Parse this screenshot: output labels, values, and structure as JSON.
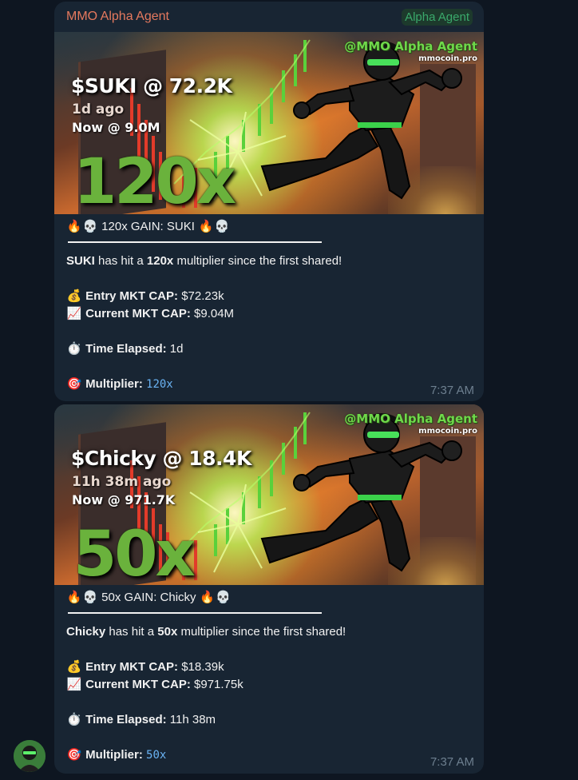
{
  "chat": {
    "sender_name": "MMO Alpha Agent",
    "admin_badge": "Alpha Agent",
    "avatar_icon": "agent-avatar"
  },
  "messages": [
    {
      "banner": {
        "watermark": "@MMO Alpha Agent",
        "site": "mmocoin.pro",
        "title": "$SUKI @ 72.2K",
        "ago": "1d ago",
        "now": "Now @ 9.0M",
        "multiplier": "120x"
      },
      "headline": "120x GAIN: SUKI",
      "token": "SUKI",
      "has_hit_a": "has hit a",
      "mult": "120x",
      "since": "multiplier since the first shared!",
      "entry_label": "Entry MKT CAP:",
      "entry_value": "$72.23k",
      "current_label": "Current MKT CAP:",
      "current_value": "$9.04M",
      "elapsed_label": "Time Elapsed:",
      "elapsed_value": "1d",
      "multiplier_label": "Multiplier:",
      "multiplier_value": "120x",
      "time": "7:37 AM"
    },
    {
      "banner": {
        "watermark": "@MMO Alpha Agent",
        "site": "mmocoin.pro",
        "title": "$Chicky @ 18.4K",
        "ago": "11h 38m ago",
        "now": "Now @ 971.7K",
        "multiplier": "50x"
      },
      "headline": "50x GAIN: Chicky",
      "token": "Chicky",
      "has_hit_a": "has hit a",
      "mult": "50x",
      "since": "multiplier since the first shared!",
      "entry_label": "Entry MKT CAP:",
      "entry_value": "$18.39k",
      "current_label": "Current MKT CAP:",
      "current_value": "$971.75k",
      "elapsed_label": "Time Elapsed:",
      "elapsed_value": "11h 38m",
      "multiplier_label": "Multiplier:",
      "multiplier_value": "50x",
      "time": "7:37 AM"
    }
  ],
  "emoji": {
    "fire": "🔥",
    "skull": "💀",
    "money_bag": "💰",
    "chart": "📈",
    "stopwatch": "⏱️",
    "target": "🎯"
  },
  "colors": {
    "background": "#0e1621",
    "bubble": "#182533",
    "sender": "#e5795e",
    "badge": "#3aa96b",
    "code": "#6ab3f3",
    "banner_multiplier": "#6ab23c"
  }
}
